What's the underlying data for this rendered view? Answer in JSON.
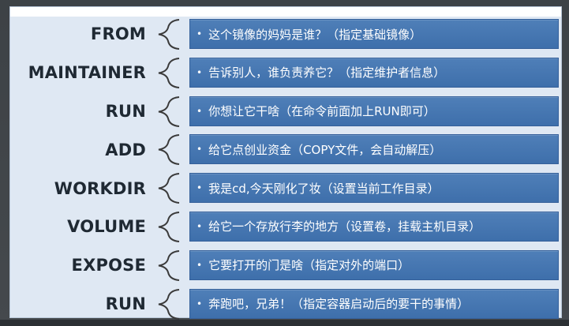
{
  "rows": [
    {
      "keyword": "FROM",
      "desc": "这个镜像的妈妈是谁？（指定基础镜像）"
    },
    {
      "keyword": "MAINTAINER",
      "desc": "告诉别人，谁负责养它？（指定维护者信息）"
    },
    {
      "keyword": "RUN",
      "desc": "你想让它干啥（在命令前面加上RUN即可）"
    },
    {
      "keyword": "ADD",
      "desc": "给它点创业资金（COPY文件，会自动解压）"
    },
    {
      "keyword": "WORKDIR",
      "desc": "我是cd,今天刚化了妆（设置当前工作目录）"
    },
    {
      "keyword": "VOLUME",
      "desc": "给它一个存放行李的地方（设置卷，挂载主机目录）"
    },
    {
      "keyword": "EXPOSE",
      "desc": "它要打开的门是啥（指定对外的端口）"
    },
    {
      "keyword": "RUN",
      "desc": "奔跑吧，兄弟！（指定容器启动后的要干的事情）"
    }
  ],
  "bullet": "•",
  "colors": {
    "box": "#4477b3",
    "brace": "#3a3a3a",
    "background": "#dfe8f3"
  }
}
